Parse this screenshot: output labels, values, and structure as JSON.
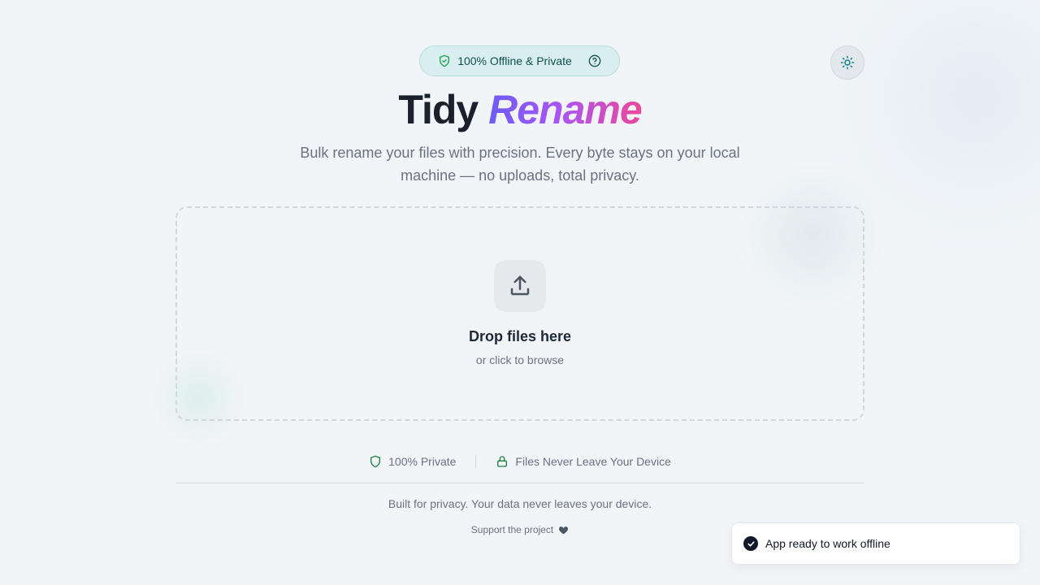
{
  "badge": {
    "text": "100% Offline & Private",
    "shield_icon": "shield-check-icon",
    "help_icon": "help-circle-icon"
  },
  "theme_toggle": {
    "icon": "sun-icon"
  },
  "hero": {
    "title_part1": "Tidy",
    "title_part2": "Rename",
    "subtitle": "Bulk rename your files with precision. Every byte stays on your local machine — no uploads, total privacy."
  },
  "dropzone": {
    "icon": "upload-icon",
    "title": "Drop files here",
    "subtitle": "or click to browse"
  },
  "features": [
    {
      "icon": "shield-icon",
      "label": "100% Private"
    },
    {
      "icon": "lock-icon",
      "label": "Files Never Leave Your Device"
    }
  ],
  "footer": {
    "text": "Built for privacy. Your data never leaves your device.",
    "support_label": "Support the project",
    "support_icon": "heart-icon"
  },
  "toast": {
    "icon": "check-circle-icon",
    "message": "App ready to work offline"
  },
  "colors": {
    "accent_teal": "#0e7c86",
    "gradient_start": "#6d5cf6",
    "gradient_end": "#ec4899",
    "success_green": "#16a34a"
  }
}
